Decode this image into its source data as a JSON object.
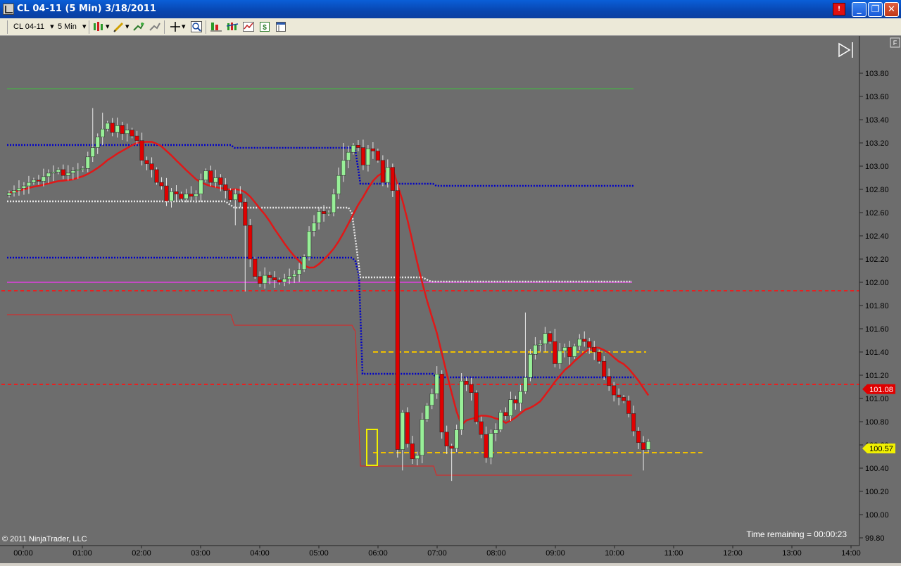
{
  "window": {
    "title": "CL 04-11 (5 Min)  3/18/2011",
    "alert_label": "!",
    "minimize_glyph": "_",
    "maximize_glyph": "❐",
    "close_glyph": "✕"
  },
  "toolbar": {
    "instrument": "CL 04-11",
    "interval": "5 Min",
    "dropdown_glyph": "▾"
  },
  "chart": {
    "copyright": "© 2011 NinjaTrader, LLC",
    "time_remaining": "Time remaining = 00:00:23",
    "panel_tag": "F",
    "last_price_label": "100.57",
    "ma_price_label": "101.08",
    "colors": {
      "background": "#6d6d6d",
      "up_candle": "#98f098",
      "down_candle": "#e00000",
      "moving_average": "#e01818",
      "pivot_blue": "#0000c8",
      "pivot_white": "#e8e8e8",
      "support_red": "#e82020",
      "yellow_level": "#f0c000",
      "magenta_level": "#e040e0",
      "green_level": "#40c040"
    }
  },
  "chart_data": {
    "type": "candlestick",
    "instrument": "CL 04-11",
    "interval": "5 Min",
    "date": "3/18/2011",
    "x_ticks": [
      "00:00",
      "01:00",
      "02:00",
      "03:00",
      "04:00",
      "05:00",
      "06:00",
      "07:00",
      "08:00",
      "09:00",
      "10:00",
      "11:00",
      "12:00",
      "13:00",
      "14:00"
    ],
    "y_ticks": [
      "103.80",
      "103.60",
      "103.40",
      "103.20",
      "103.00",
      "102.80",
      "102.60",
      "102.40",
      "102.20",
      "102.00",
      "101.80",
      "101.60",
      "101.40",
      "101.20",
      "101.00",
      "100.80",
      "100.60",
      "100.40",
      "100.20",
      "100.00",
      "99.80"
    ],
    "ylim": [
      99.8,
      103.9
    ],
    "last_price": 100.57,
    "ma_last": 101.08,
    "closes": [
      102.77,
      102.79,
      102.81,
      102.83,
      102.86,
      102.88,
      102.87,
      102.91,
      102.94,
      102.95,
      102.97,
      102.92,
      102.94,
      102.96,
      102.97,
      102.98,
      103.08,
      103.16,
      103.25,
      103.32,
      103.37,
      103.29,
      103.35,
      103.28,
      103.31,
      103.26,
      103.22,
      103.05,
      103.02,
      102.97,
      102.86,
      102.83,
      102.7,
      102.78,
      102.76,
      102.72,
      102.76,
      102.74,
      102.76,
      102.88,
      102.96,
      102.86,
      102.9,
      102.84,
      102.79,
      102.71,
      102.76,
      102.69,
      102.49,
      102.2,
      102.05,
      101.99,
      102.06,
      102.04,
      102.02,
      102.0,
      102.03,
      102.05,
      102.07,
      102.11,
      102.22,
      102.44,
      102.51,
      102.61,
      102.59,
      102.6,
      102.76,
      102.92,
      103.05,
      103.12,
      103.18,
      103.16,
      103.01,
      103.15,
      103.13,
      103.05,
      102.86,
      102.99,
      102.79,
      100.56,
      100.88,
      100.61,
      100.48,
      100.51,
      100.82,
      100.94,
      101.04,
      101.21,
      100.71,
      100.59,
      100.57,
      100.73,
      101.15,
      101.12,
      101.05,
      100.8,
      100.69,
      100.49,
      100.7,
      100.73,
      100.88,
      100.85,
      100.99,
      100.96,
      101.06,
      101.18,
      101.38,
      101.46,
      101.47,
      101.56,
      101.49,
      101.3,
      101.41,
      101.44,
      101.36,
      101.45,
      101.51,
      101.49,
      101.44,
      101.4,
      101.32,
      101.19,
      101.11,
      101.03,
      101.01,
      100.98,
      100.87,
      100.72,
      100.62,
      100.56,
      100.63
    ]
  }
}
